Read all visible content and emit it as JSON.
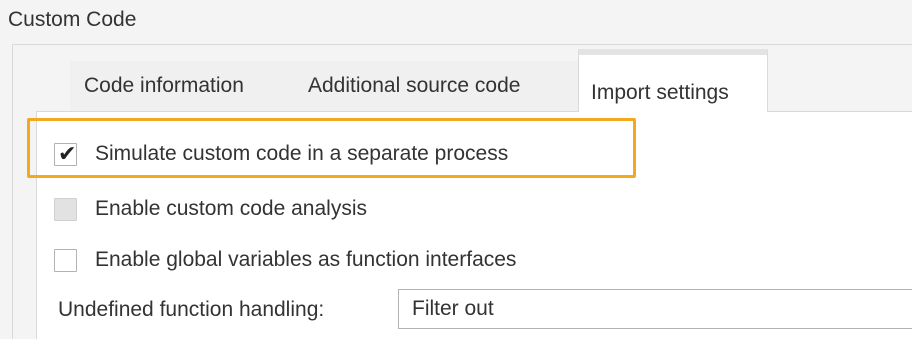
{
  "section": {
    "title": "Custom Code"
  },
  "tabs": [
    {
      "label": "Code information"
    },
    {
      "label": "Additional source code"
    },
    {
      "label": "Import settings"
    }
  ],
  "options": [
    {
      "label": "Simulate custom code in a separate process",
      "checked": true
    },
    {
      "label": "Enable custom code analysis",
      "checked": false,
      "enabled": false
    },
    {
      "label": "Enable global variables as function interfaces",
      "checked": false
    }
  ],
  "undefined_handling": {
    "label": "Undefined function handling:",
    "value": "Filter out"
  },
  "colors": {
    "highlight": "#f3a91f",
    "text": "#333333",
    "border": "#d9d9d9"
  }
}
